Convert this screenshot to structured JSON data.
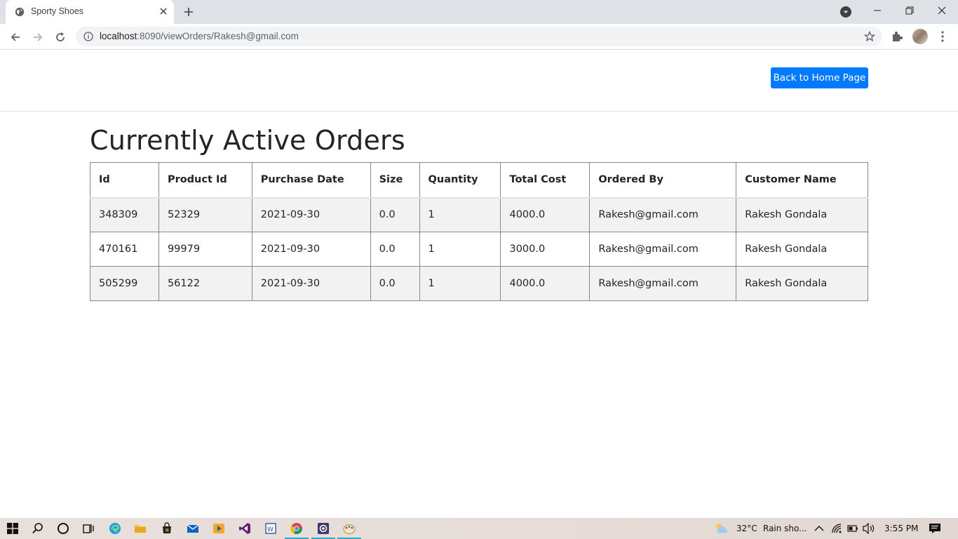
{
  "browser": {
    "tab": {
      "title": "Sporty Shoes",
      "favicon": "globe-icon"
    },
    "url": {
      "host": "localhost",
      "rest": ":8090/viewOrders/Rakesh@gmail.com"
    }
  },
  "page": {
    "home_button": "Back to Home Page",
    "title": "Currently Active Orders",
    "table": {
      "headers": [
        "Id",
        "Product Id",
        "Purchase Date",
        "Size",
        "Quantity",
        "Total Cost",
        "Ordered By",
        "Customer Name"
      ],
      "rows": [
        [
          "348309",
          "52329",
          "2021-09-30",
          "0.0",
          "1",
          "4000.0",
          "Rakesh@gmail.com",
          "Rakesh Gondala"
        ],
        [
          "470161",
          "99979",
          "2021-09-30",
          "0.0",
          "1",
          "3000.0",
          "Rakesh@gmail.com",
          "Rakesh Gondala"
        ],
        [
          "505299",
          "56122",
          "2021-09-30",
          "0.0",
          "1",
          "4000.0",
          "Rakesh@gmail.com",
          "Rakesh Gondala"
        ]
      ]
    },
    "accent_color": "#007bff"
  },
  "taskbar": {
    "weather": "32°C",
    "weather_desc": "Rain sho...",
    "time": "3:55 PM",
    "pinned_apps": [
      "windows-start-icon",
      "search-icon",
      "cortana-icon",
      "task-view-icon",
      "edge-icon",
      "file-explorer-icon",
      "store-icon",
      "mail-icon",
      "media-player-icon",
      "visual-studio-icon",
      "word-icon",
      "chrome-icon",
      "app-icon",
      "paint-icon"
    ]
  }
}
